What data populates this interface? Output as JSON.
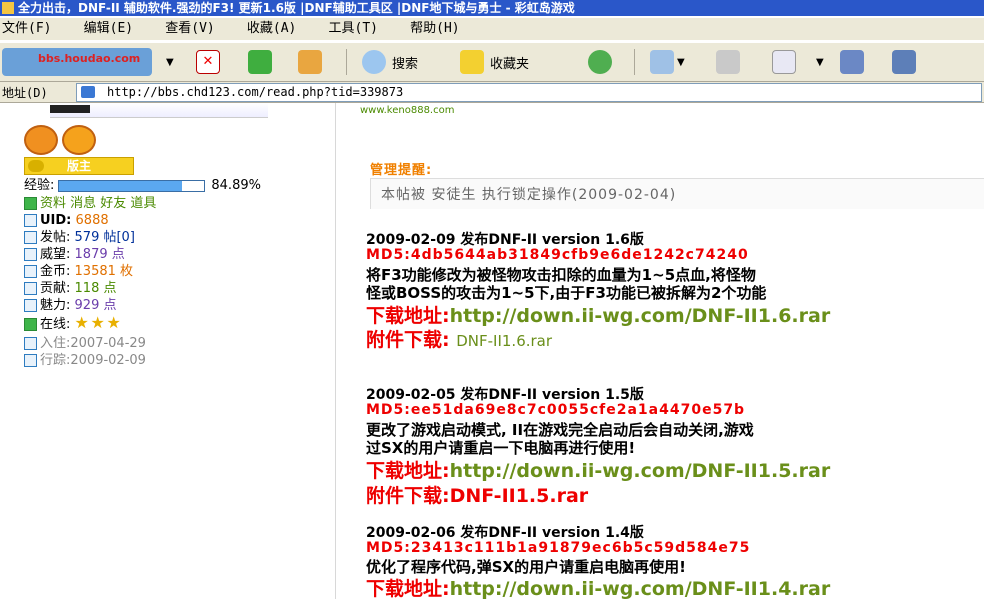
{
  "window": {
    "title": "全力出击，DNF-II 辅助软件.强劲的F3! 更新1.6版 |DNF辅助工具区 |DNF地下城与勇士 - 彩虹岛游戏"
  },
  "menu": [
    "文件(F)",
    "编辑(E)",
    "查看(V)",
    "收藏(A)",
    "工具(T)",
    "帮助(H)"
  ],
  "toolbar": {
    "logo_text": "bbs.houdao.com",
    "search_label": "搜索",
    "favorites_label": "收藏夹"
  },
  "address": {
    "label": "地址(D)",
    "url": "http://bbs.chd123.com/read.php?tid=339873"
  },
  "profile": {
    "rank": "版主",
    "exp_label": "经验:",
    "exp_percent": "84.89%",
    "exp_fraction": 0.8489,
    "links": "资料 消息 好友 道具",
    "uid_label": "UID:",
    "uid": "6888",
    "posts_label": "发帖:",
    "posts": "579 帖[0]",
    "prestige_label": "威望:",
    "prestige": "1879 点",
    "gold_label": "金币:",
    "gold": "13581 枚",
    "contrib_label": "贡献:",
    "contrib": "118 点",
    "charm_label": "魅力:",
    "charm": "929 点",
    "online_label": "在线:",
    "online_stars": 3,
    "joined": "入住:2007-04-29",
    "track": "行踪:2009-02-09"
  },
  "post": {
    "site_link": "www.keno888.com",
    "admin_title": "管理提醒:",
    "admin_text": "本帖被 安徒生 执行锁定操作(2009-02-04)",
    "releases": [
      {
        "date": "2009-02-09 发布DNF-II version 1.6版",
        "md5": "MD5:4db5644ab31849cfb9e6de1242c74240",
        "desc1": "将F3功能修改为被怪物攻击扣除的血量为1~5点血,将怪物",
        "desc2": "怪或BOSS的攻击为1~5下,由于F3功能已被拆解为2个功能",
        "dl_label": "下载地址:",
        "dl_url": "http://down.ii-wg.com/DNF-II1.6.rar",
        "att_label": "附件下载:",
        "att_file": "DNF-II1.6.rar"
      },
      {
        "date": "2009-02-05 发布DNF-II version 1.5版",
        "md5": "MD5:ee51da69e8c7c0055cfe2a1a4470e57b",
        "desc1": "更改了游戏启动模式, II在游戏完全启动后会自动关闭,游戏",
        "desc2": "过SX的用户请重启一下电脑再进行使用!",
        "dl_label": "下载地址:",
        "dl_url": "http://down.ii-wg.com/DNF-II1.5.rar",
        "att_label": "附件下载:",
        "att_file": "DNF-II1.5.rar"
      },
      {
        "date": "2009-02-06 发布DNF-II version 1.4版",
        "md5": "MD5:23413c111b1a91879ec6b5c59d584e75",
        "desc1": "优化了程序代码,弹SX的用户请重启电脑再使用!",
        "dl_label": "下载地址:",
        "dl_url": "http://down.ii-wg.com/DNF-II1.4.rar"
      }
    ]
  }
}
